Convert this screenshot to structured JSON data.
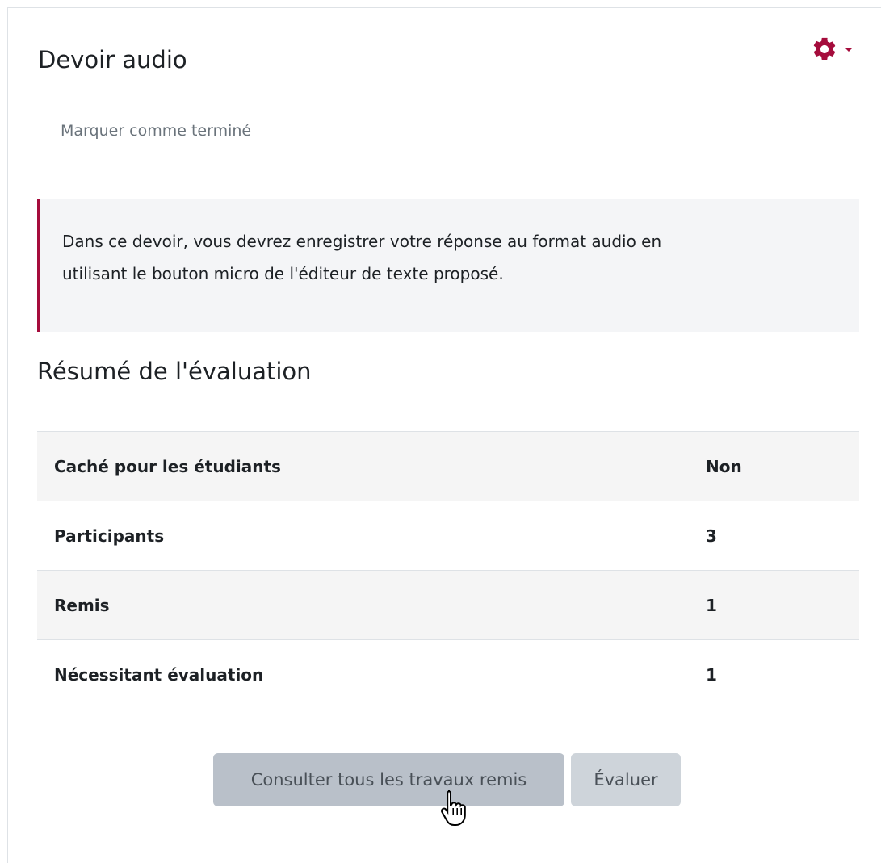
{
  "header": {
    "title": "Devoir audio",
    "settings_menu_icon": "gear-icon",
    "accent_color": "#a50c3c"
  },
  "completion": {
    "mark_done_label": "Marquer comme terminé"
  },
  "intro": {
    "line1": "Dans ce devoir, vous devrez enregistrer votre réponse au format audio en",
    "line2": "utilisant le bouton micro de l'éditeur de texte proposé."
  },
  "summary": {
    "title": "Résumé de l'évaluation",
    "rows": [
      {
        "label": "Caché pour les étudiants",
        "value": "Non"
      },
      {
        "label": "Participants",
        "value": "3"
      },
      {
        "label": "Remis",
        "value": "1"
      },
      {
        "label": "Nécessitant évaluation",
        "value": "1"
      }
    ]
  },
  "actions": {
    "view_all_label": "Consulter tous les travaux remis",
    "grade_label": "Évaluer"
  }
}
